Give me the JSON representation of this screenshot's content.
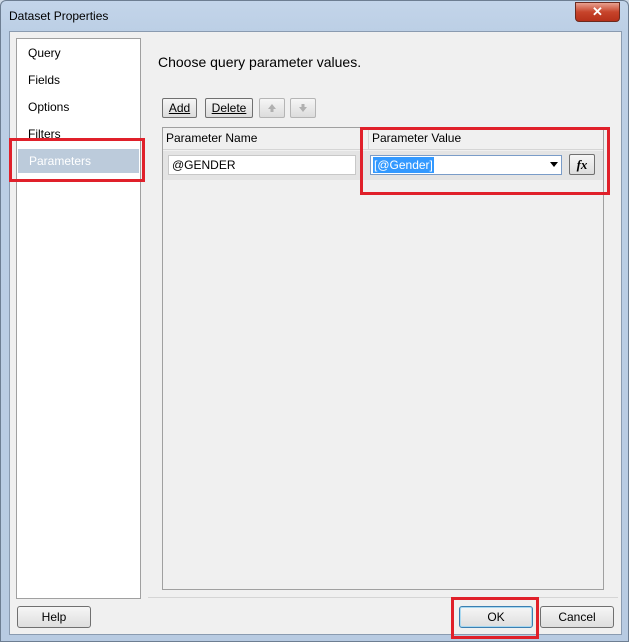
{
  "window": {
    "title": "Dataset Properties",
    "close_label": "✕"
  },
  "sidebar": {
    "items": [
      {
        "label": "Query"
      },
      {
        "label": "Fields"
      },
      {
        "label": "Options"
      },
      {
        "label": "Filters"
      },
      {
        "label": "Parameters",
        "selected": true
      }
    ]
  },
  "main": {
    "heading": "Choose query parameter values.",
    "toolbar": {
      "add_label": "Add",
      "delete_label": "Delete",
      "move_up_icon": "arrow-up-icon",
      "move_down_icon": "arrow-down-icon"
    },
    "grid": {
      "columns": [
        "Parameter Name",
        "Parameter Value"
      ],
      "rows": [
        {
          "name": "@GENDER",
          "value": "[@Gender]",
          "expression_label": "fx"
        }
      ]
    }
  },
  "footer": {
    "help_label": "Help",
    "ok_label": "OK",
    "cancel_label": "Cancel"
  },
  "colors": {
    "annotation": "#e0202a",
    "selection": "#3399ff",
    "selected_nav": "#bccbdb"
  }
}
